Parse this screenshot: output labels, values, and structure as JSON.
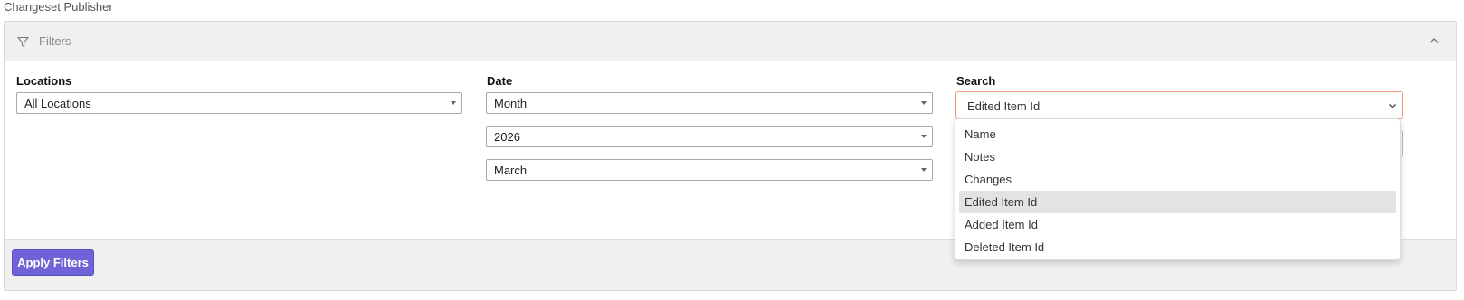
{
  "page": {
    "title": "Changeset Publisher"
  },
  "filters": {
    "header_label": "Filters",
    "locations": {
      "label": "Locations",
      "value": "All Locations"
    },
    "date": {
      "label": "Date",
      "period": "Month",
      "year": "2026",
      "month": "March"
    },
    "search": {
      "label": "Search",
      "value": "Edited Item Id",
      "options": [
        {
          "label": "Name",
          "selected": false
        },
        {
          "label": "Notes",
          "selected": false
        },
        {
          "label": "Changes",
          "selected": false
        },
        {
          "label": "Edited Item Id",
          "selected": true
        },
        {
          "label": "Added Item Id",
          "selected": false
        },
        {
          "label": "Deleted Item Id",
          "selected": false
        }
      ]
    },
    "apply_label": "Apply Filters"
  },
  "colors": {
    "accent": "#6f63d8",
    "focus_border": "#f19a7b",
    "header_bg": "#f0f0f0"
  },
  "icons": {
    "filter": "filter-icon",
    "collapse": "chevron-up-icon",
    "select_arrow": "chevron-down-icon"
  }
}
